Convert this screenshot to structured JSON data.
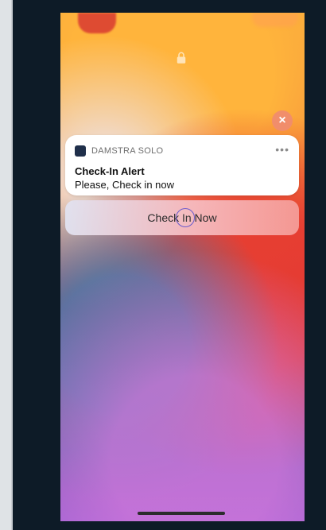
{
  "notification": {
    "app_name": "DAMSTRA SOLO",
    "title": "Check-In Alert",
    "body": "Please, Check in now",
    "more_label": "•••",
    "dismiss_label": "×"
  },
  "action": {
    "check_in_label": "Check In Now"
  },
  "icons": {
    "lock": "lock-icon",
    "app": "app-icon",
    "dismiss": "close-icon",
    "more": "ellipsis-icon"
  },
  "colors": {
    "accent": "#6a5acd",
    "app_icon": "#1f2f4a",
    "dismiss_button": "#f08c6e"
  }
}
